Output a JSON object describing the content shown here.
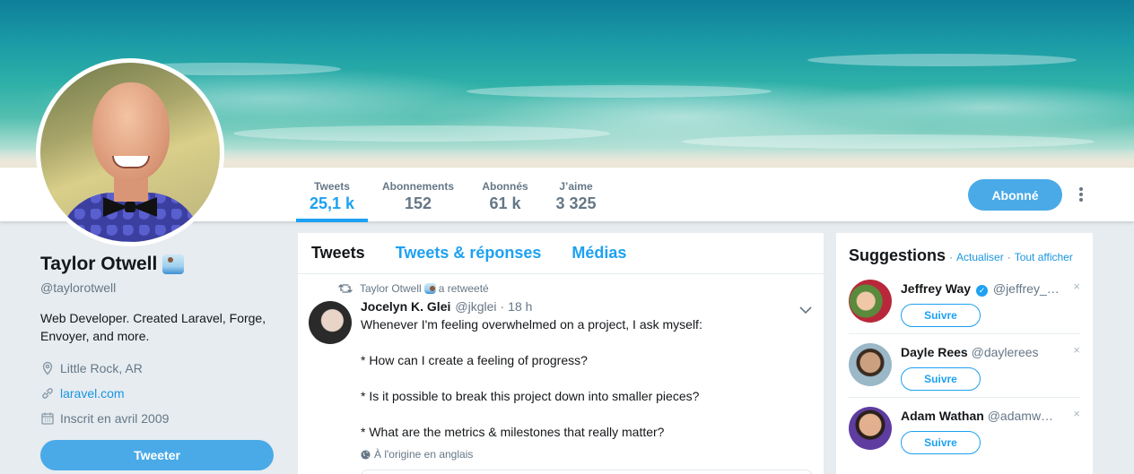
{
  "profile": {
    "name": "Taylor Otwell",
    "handle": "@taylorotwell",
    "bio": "Web Developer. Created Laravel, Forge, Envoyer, and more.",
    "location": "Little Rock, AR",
    "website": "laravel.com",
    "joined": "Inscrit en avril 2009",
    "tweet_button": "Tweeter",
    "name_emoji": "surfer-emoji"
  },
  "stats": [
    {
      "label": "Tweets",
      "value": "25,1 k",
      "active": true
    },
    {
      "label": "Abonnements",
      "value": "152",
      "active": false
    },
    {
      "label": "Abonnés",
      "value": "61 k",
      "active": false
    },
    {
      "label": "J’aime",
      "value": "3 325",
      "active": false
    }
  ],
  "follow_button": "Abonné",
  "timeline": {
    "tabs": [
      "Tweets",
      "Tweets & réponses",
      "Médias"
    ],
    "tweet": {
      "retweet_context": "Taylor Otwell",
      "retweet_suffix": "a retweeté",
      "author_name": "Jocelyn K. Glei",
      "author_handle": "@jkglei",
      "dot": "·",
      "time": "18 h",
      "lines": [
        "Whenever I'm feeling overwhelmed on a project, I ask myself:",
        "",
        "* How can I create a feeling of progress?",
        "",
        "* Is it possible to break this project down into smaller pieces?",
        "",
        "* What are the metrics & milestones that really matter?"
      ],
      "origin": "À l'origine en anglais"
    }
  },
  "suggestions": {
    "title": "Suggestions",
    "refresh": "Actualiser",
    "sep": "·",
    "view_all": "Tout afficher",
    "follow_label": "Suivre",
    "close": "×",
    "items": [
      {
        "name": "Jeffrey Way",
        "handle": "@jeffrey_…",
        "verified": true
      },
      {
        "name": "Dayle Rees",
        "handle": "@daylerees",
        "verified": false
      },
      {
        "name": "Adam Wathan",
        "handle": "@adamw…",
        "verified": false
      }
    ]
  },
  "colors": {
    "accent": "#1da1f2",
    "button": "#4aaae8",
    "muted": "#657786",
    "background": "#e6ecf0"
  }
}
